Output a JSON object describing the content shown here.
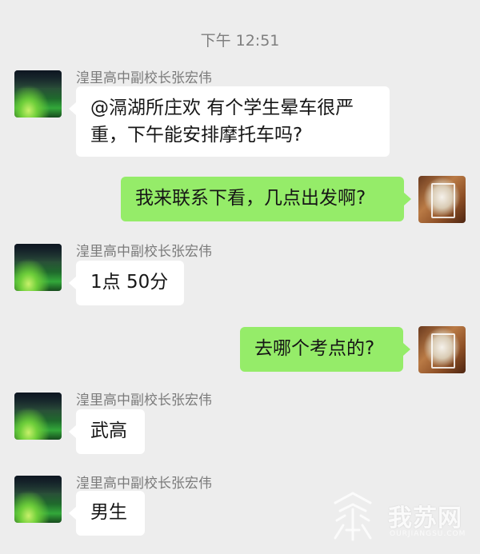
{
  "chat": {
    "timestamp": "下午 12:51",
    "messages": [
      {
        "side": "left",
        "sender": "湟里高中副校长张宏伟",
        "lines": [
          "@滆湖所庄欢 有个学生晕车很严",
          "重，下午能安排摩托车吗?"
        ]
      },
      {
        "side": "right",
        "text": "我来联系下看，几点出发啊?"
      },
      {
        "side": "left",
        "sender": "湟里高中副校长张宏伟",
        "text": "1点 50分"
      },
      {
        "side": "right",
        "text": "去哪个考点的?"
      },
      {
        "side": "left",
        "sender": "湟里高中副校长张宏伟",
        "text": "武高"
      },
      {
        "side": "left",
        "sender": "湟里高中副校长张宏伟",
        "text": "男生"
      }
    ]
  },
  "watermark": {
    "text": "我苏网",
    "sub": "OURJIANGSU.COM"
  },
  "colors": {
    "background": "#ededed",
    "bubble_left": "#ffffff",
    "bubble_right": "#95ec69"
  }
}
